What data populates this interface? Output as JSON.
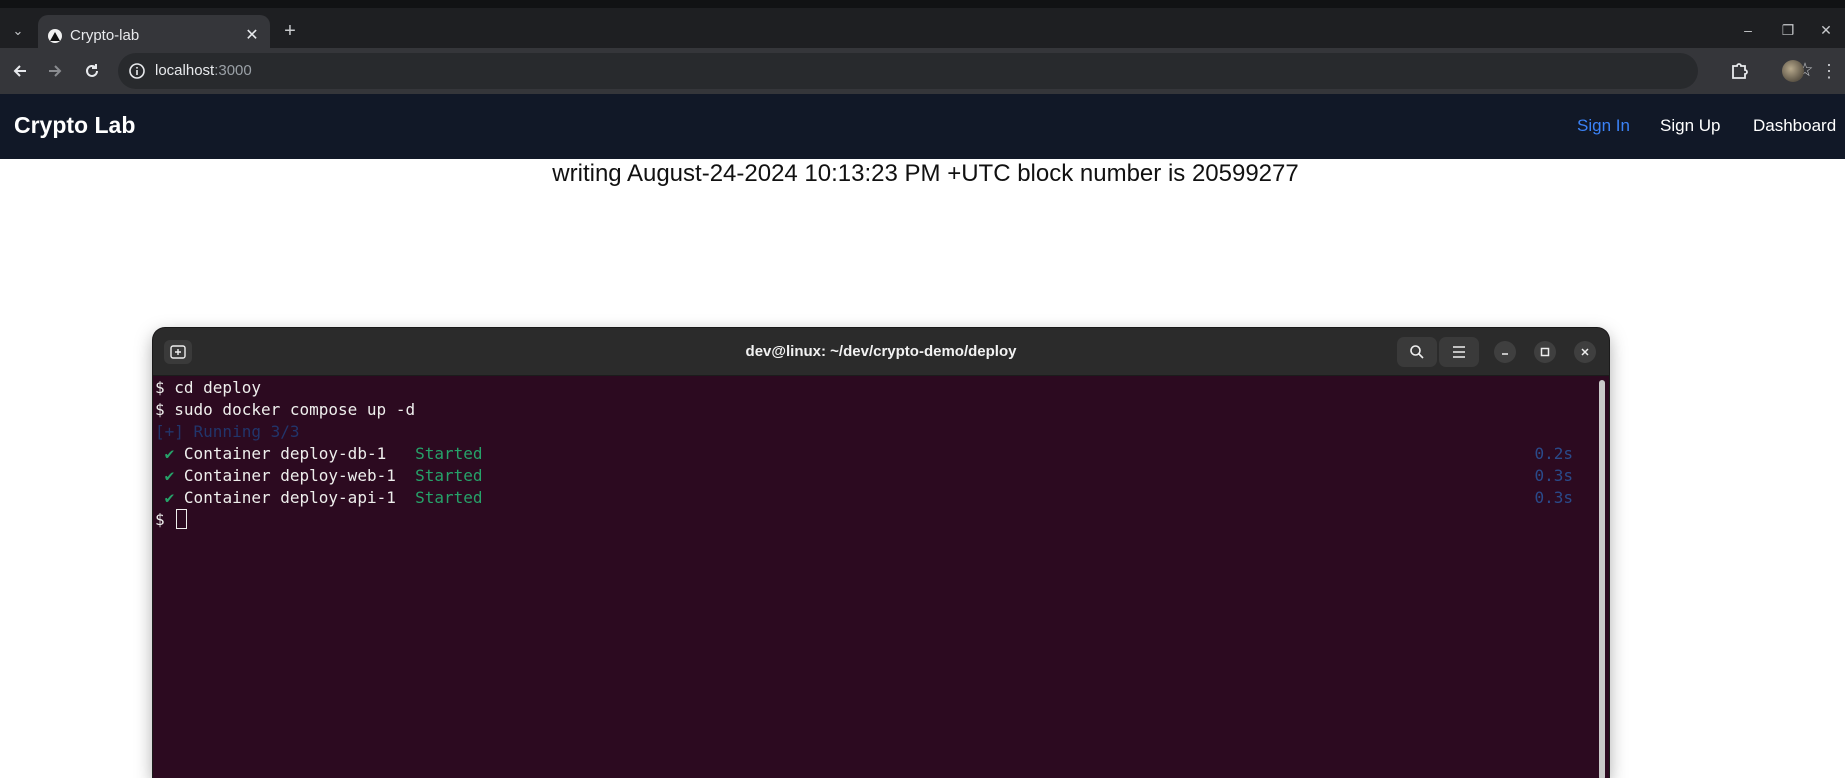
{
  "browser": {
    "tab_title": "Crypto-lab",
    "url_host": "localhost",
    "url_port": ":3000"
  },
  "app": {
    "brand": "Crypto Lab",
    "nav": {
      "sign_in": "Sign In",
      "sign_up": "Sign Up",
      "dashboard": "Dashboard"
    },
    "headline": "writing August-24-2024 10:13:23 PM +UTC block number is 20599277",
    "colors": {
      "appbar": "#111827",
      "active_link": "#3b82f6"
    }
  },
  "terminal": {
    "title": "dev@linux: ~/dev/crypto-demo/deploy",
    "lines": {
      "l1": "$ cd deploy",
      "l2": "$ sudo docker compose up -d",
      "l3": "[+] Running 3/3",
      "prompt": "$ "
    },
    "containers": [
      {
        "check": "✔",
        "name": "Container deploy-db-1  ",
        "status": "Started",
        "time": "0.2s"
      },
      {
        "check": "✔",
        "name": "Container deploy-web-1 ",
        "status": "Started",
        "time": "0.3s"
      },
      {
        "check": "✔",
        "name": "Container deploy-api-1 ",
        "status": "Started",
        "time": "0.3s"
      }
    ],
    "colors": {
      "background": "#2c0a20",
      "success": "#26a269",
      "dim": "#22356b"
    }
  }
}
